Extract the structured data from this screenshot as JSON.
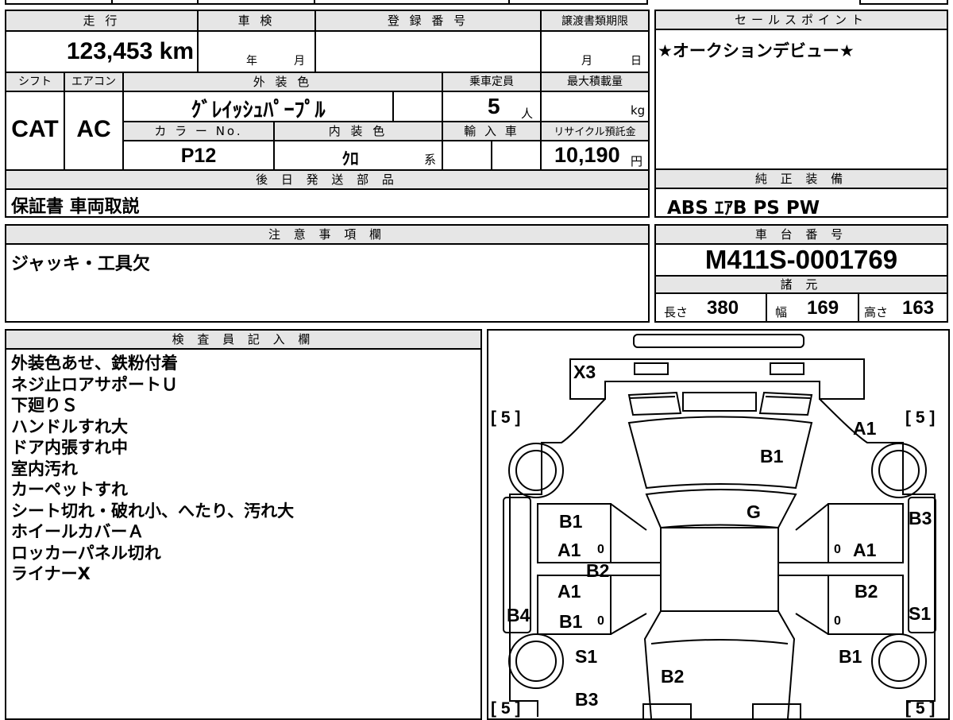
{
  "spec": {
    "mileage_label": "走 行",
    "mileage": "123,453",
    "mileage_unit": "km",
    "inspection_label": "車 検",
    "inspection_year": "年",
    "inspection_month": "月",
    "registration_label": "登 録 番 号",
    "registration_value": "",
    "transfer_deadline_label": "譲渡書類期限",
    "transfer_month": "月",
    "transfer_day": "日",
    "shift_label": "シフト",
    "shift": "CAT",
    "ac_label": "エアコン",
    "ac": "AC",
    "exterior_color_label": "外 装 色",
    "exterior_color": "ｸﾞﾚｲｯｼｭﾊﾟｰﾌﾟﾙ",
    "capacity_label": "乗車定員",
    "capacity": "5",
    "capacity_unit": "人",
    "max_load_label": "最大積載量",
    "max_load": "",
    "max_load_unit": "kg",
    "color_no_label": "カ ラ ー No.",
    "color_no": "P12",
    "interior_color_label": "内 装 色",
    "interior_color": "ｸﾛ",
    "interior_color_suffix": "系",
    "import_label": "輸 入 車",
    "recycle_label": "リサイクル預託金",
    "recycle_fee": "10,190",
    "recycle_unit": "円"
  },
  "later_parts": {
    "label": "後 日 発 送 部 品",
    "value": "保証書 車両取説"
  },
  "notes": {
    "label": "注 意 事 項 欄",
    "value": "ジャッキ・工具欠"
  },
  "sales_point": {
    "label": "セールスポイント",
    "value": "★オークションデビュー★"
  },
  "equipment": {
    "label": "純 正 装 備",
    "value": "ABS ｴｱB PS PW"
  },
  "chassis": {
    "label": "車 台 番 号",
    "value": "M411S-0001769",
    "dims_label": "諸 元",
    "length_label": "長さ",
    "length": "380",
    "width_label": "幅",
    "width": "169",
    "height_label": "高さ",
    "height": "163"
  },
  "inspector": {
    "label": "検 査 員 記 入 欄",
    "lines": [
      "外装色あせ、鉄粉付着",
      "ネジ止ロアサポートＵ",
      "下廻りＳ",
      "ハンドルすれ大",
      "ドア内張すれ中",
      "室内汚れ",
      "カーペットすれ",
      "シート切れ・破れ小、へたり、汚れ大",
      "ホイールカバーＡ",
      "ロッカーパネル切れ",
      "ライナーX"
    ]
  },
  "diagram": {
    "marks": [
      "X3",
      "A1",
      "B1",
      "G",
      "B1",
      "A1",
      "B2",
      "A1",
      "B1",
      "B4",
      "S1",
      "B2",
      "B3",
      "B3",
      "A1",
      "B2",
      "S1",
      "B1"
    ],
    "tires": [
      "[ 5 ]",
      "[ 5 ]",
      "[ 5 ]",
      "[ 5 ]"
    ],
    "zeros": [
      "0",
      "0",
      "0",
      "0"
    ]
  }
}
